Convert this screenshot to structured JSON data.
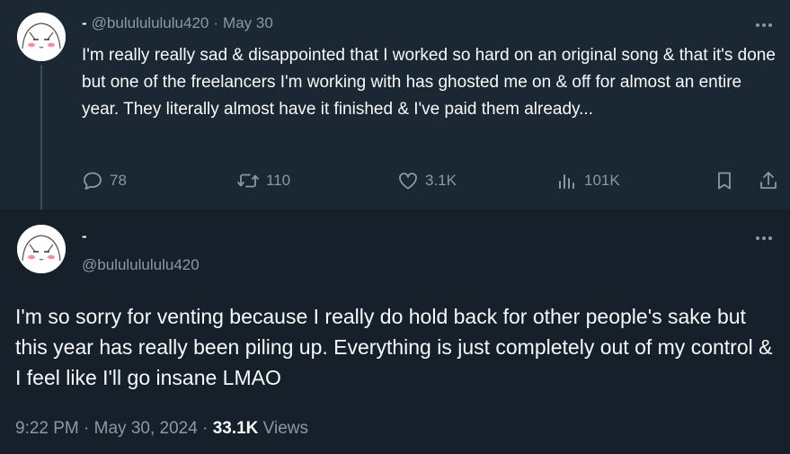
{
  "reply_tweet": {
    "display_name": "-",
    "handle": "@bulululululu420",
    "separator": "·",
    "date": "May 30",
    "text": "I'm really really sad & disappointed that I worked so hard on an original song & that it's done but one of the freelancers I'm working with has ghosted me on & off for almost an entire year. They literally almost have it finished & I've paid them already...",
    "actions": {
      "replies": "78",
      "retweets": "110",
      "likes": "3.1K",
      "views": "101K"
    }
  },
  "main_tweet": {
    "display_name": "-",
    "handle": "@bulululululu420",
    "text": "I'm so sorry for venting because I really do hold back for other people's sake but this year has really been piling up. Everything is just completely out of my control & I feel like I'll go insane LMAO",
    "time": "9:22 PM",
    "separator": "·",
    "date": "May 30, 2024",
    "views_count": "33.1K",
    "views_label": "Views"
  },
  "icons": {
    "more": "more-dots-icon",
    "reply": "reply-icon",
    "retweet": "retweet-icon",
    "like": "heart-icon",
    "views": "views-chart-icon",
    "bookmark": "bookmark-icon",
    "share": "share-icon"
  },
  "colors": {
    "background": "#15202b",
    "reply_background": "#1b2733",
    "text": "#f7f9f9",
    "muted": "#8b98a5"
  }
}
